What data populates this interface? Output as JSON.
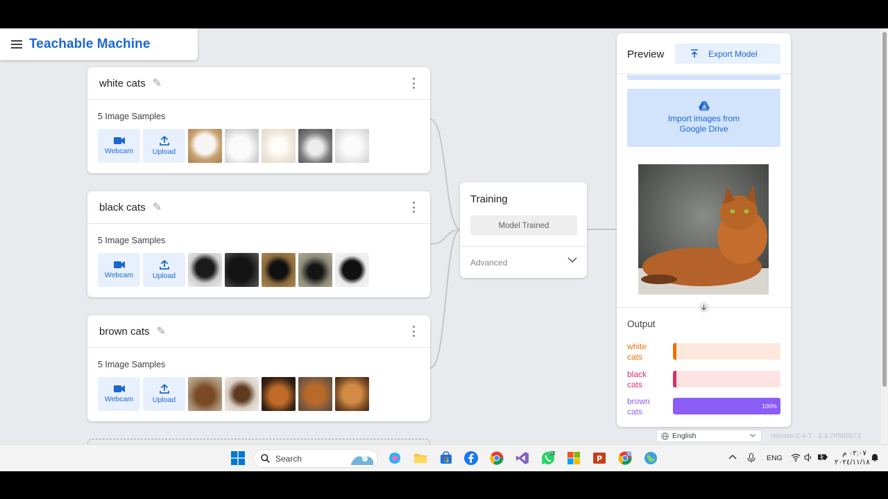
{
  "header": {
    "title": "Teachable Machine"
  },
  "classes": [
    {
      "name": "white cats",
      "samples": "5 Image Samples",
      "webcam": "Webcam",
      "upload": "Upload"
    },
    {
      "name": "black cats",
      "samples": "5 Image Samples",
      "webcam": "Webcam",
      "upload": "Upload"
    },
    {
      "name": "brown cats",
      "samples": "5 Image Samples",
      "webcam": "Webcam",
      "upload": "Upload"
    }
  ],
  "training": {
    "title": "Training",
    "button": "Model Trained",
    "advanced": "Advanced"
  },
  "preview": {
    "title": "Preview",
    "export": "Export Model",
    "drive_line1": "Import images from",
    "drive_line2": "Google Drive",
    "output_title": "Output",
    "outputs": [
      {
        "line1": "white",
        "line2": "cats",
        "percent": 0,
        "label_color": "#e8710a",
        "track_color": "#fde9dc",
        "fill_color": "#e8710a",
        "value_text": ""
      },
      {
        "line1": "black",
        "line2": "cats",
        "percent": 0,
        "label_color": "#d93067",
        "track_color": "#fde3e4",
        "fill_color": "#d93067",
        "value_text": ""
      },
      {
        "line1": "brown",
        "line2": "cats",
        "percent": 100,
        "label_color": "#8b5cf6",
        "track_color": "#ede7fb",
        "fill_color": "#8b5cf6",
        "value_text": "100%"
      }
    ]
  },
  "footer": {
    "language": "English",
    "release": "release-2-4-7 - 2.4.7#5b5b73"
  },
  "taskbar": {
    "search": "Search",
    "lang": "ENG",
    "time": "٠٢:٠٧ م",
    "date": "٢٠٢٤/١١/١٨"
  },
  "colors": {
    "accent": "#1967d2",
    "accent_bg": "#e8f0fe",
    "drive_bg": "#d2e3fc"
  }
}
